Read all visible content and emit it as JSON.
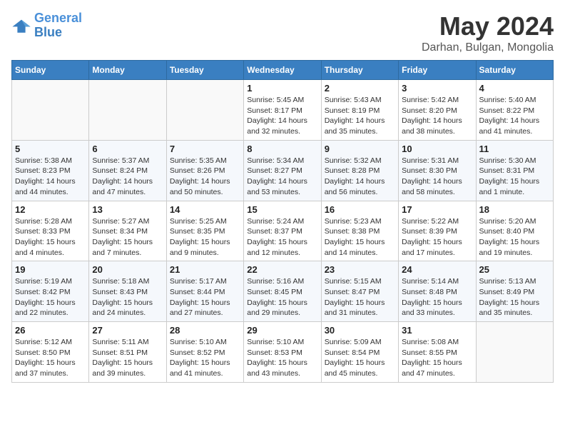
{
  "header": {
    "logo_line1": "General",
    "logo_line2": "Blue",
    "month": "May 2024",
    "location": "Darhan, Bulgan, Mongolia"
  },
  "days_of_week": [
    "Sunday",
    "Monday",
    "Tuesday",
    "Wednesday",
    "Thursday",
    "Friday",
    "Saturday"
  ],
  "weeks": [
    [
      {
        "day": "",
        "info": ""
      },
      {
        "day": "",
        "info": ""
      },
      {
        "day": "",
        "info": ""
      },
      {
        "day": "1",
        "info": "Sunrise: 5:45 AM\nSunset: 8:17 PM\nDaylight: 14 hours\nand 32 minutes."
      },
      {
        "day": "2",
        "info": "Sunrise: 5:43 AM\nSunset: 8:19 PM\nDaylight: 14 hours\nand 35 minutes."
      },
      {
        "day": "3",
        "info": "Sunrise: 5:42 AM\nSunset: 8:20 PM\nDaylight: 14 hours\nand 38 minutes."
      },
      {
        "day": "4",
        "info": "Sunrise: 5:40 AM\nSunset: 8:22 PM\nDaylight: 14 hours\nand 41 minutes."
      }
    ],
    [
      {
        "day": "5",
        "info": "Sunrise: 5:38 AM\nSunset: 8:23 PM\nDaylight: 14 hours\nand 44 minutes."
      },
      {
        "day": "6",
        "info": "Sunrise: 5:37 AM\nSunset: 8:24 PM\nDaylight: 14 hours\nand 47 minutes."
      },
      {
        "day": "7",
        "info": "Sunrise: 5:35 AM\nSunset: 8:26 PM\nDaylight: 14 hours\nand 50 minutes."
      },
      {
        "day": "8",
        "info": "Sunrise: 5:34 AM\nSunset: 8:27 PM\nDaylight: 14 hours\nand 53 minutes."
      },
      {
        "day": "9",
        "info": "Sunrise: 5:32 AM\nSunset: 8:28 PM\nDaylight: 14 hours\nand 56 minutes."
      },
      {
        "day": "10",
        "info": "Sunrise: 5:31 AM\nSunset: 8:30 PM\nDaylight: 14 hours\nand 58 minutes."
      },
      {
        "day": "11",
        "info": "Sunrise: 5:30 AM\nSunset: 8:31 PM\nDaylight: 15 hours\nand 1 minute."
      }
    ],
    [
      {
        "day": "12",
        "info": "Sunrise: 5:28 AM\nSunset: 8:33 PM\nDaylight: 15 hours\nand 4 minutes."
      },
      {
        "day": "13",
        "info": "Sunrise: 5:27 AM\nSunset: 8:34 PM\nDaylight: 15 hours\nand 7 minutes."
      },
      {
        "day": "14",
        "info": "Sunrise: 5:25 AM\nSunset: 8:35 PM\nDaylight: 15 hours\nand 9 minutes."
      },
      {
        "day": "15",
        "info": "Sunrise: 5:24 AM\nSunset: 8:37 PM\nDaylight: 15 hours\nand 12 minutes."
      },
      {
        "day": "16",
        "info": "Sunrise: 5:23 AM\nSunset: 8:38 PM\nDaylight: 15 hours\nand 14 minutes."
      },
      {
        "day": "17",
        "info": "Sunrise: 5:22 AM\nSunset: 8:39 PM\nDaylight: 15 hours\nand 17 minutes."
      },
      {
        "day": "18",
        "info": "Sunrise: 5:20 AM\nSunset: 8:40 PM\nDaylight: 15 hours\nand 19 minutes."
      }
    ],
    [
      {
        "day": "19",
        "info": "Sunrise: 5:19 AM\nSunset: 8:42 PM\nDaylight: 15 hours\nand 22 minutes."
      },
      {
        "day": "20",
        "info": "Sunrise: 5:18 AM\nSunset: 8:43 PM\nDaylight: 15 hours\nand 24 minutes."
      },
      {
        "day": "21",
        "info": "Sunrise: 5:17 AM\nSunset: 8:44 PM\nDaylight: 15 hours\nand 27 minutes."
      },
      {
        "day": "22",
        "info": "Sunrise: 5:16 AM\nSunset: 8:45 PM\nDaylight: 15 hours\nand 29 minutes."
      },
      {
        "day": "23",
        "info": "Sunrise: 5:15 AM\nSunset: 8:47 PM\nDaylight: 15 hours\nand 31 minutes."
      },
      {
        "day": "24",
        "info": "Sunrise: 5:14 AM\nSunset: 8:48 PM\nDaylight: 15 hours\nand 33 minutes."
      },
      {
        "day": "25",
        "info": "Sunrise: 5:13 AM\nSunset: 8:49 PM\nDaylight: 15 hours\nand 35 minutes."
      }
    ],
    [
      {
        "day": "26",
        "info": "Sunrise: 5:12 AM\nSunset: 8:50 PM\nDaylight: 15 hours\nand 37 minutes."
      },
      {
        "day": "27",
        "info": "Sunrise: 5:11 AM\nSunset: 8:51 PM\nDaylight: 15 hours\nand 39 minutes."
      },
      {
        "day": "28",
        "info": "Sunrise: 5:10 AM\nSunset: 8:52 PM\nDaylight: 15 hours\nand 41 minutes."
      },
      {
        "day": "29",
        "info": "Sunrise: 5:10 AM\nSunset: 8:53 PM\nDaylight: 15 hours\nand 43 minutes."
      },
      {
        "day": "30",
        "info": "Sunrise: 5:09 AM\nSunset: 8:54 PM\nDaylight: 15 hours\nand 45 minutes."
      },
      {
        "day": "31",
        "info": "Sunrise: 5:08 AM\nSunset: 8:55 PM\nDaylight: 15 hours\nand 47 minutes."
      },
      {
        "day": "",
        "info": ""
      }
    ]
  ]
}
